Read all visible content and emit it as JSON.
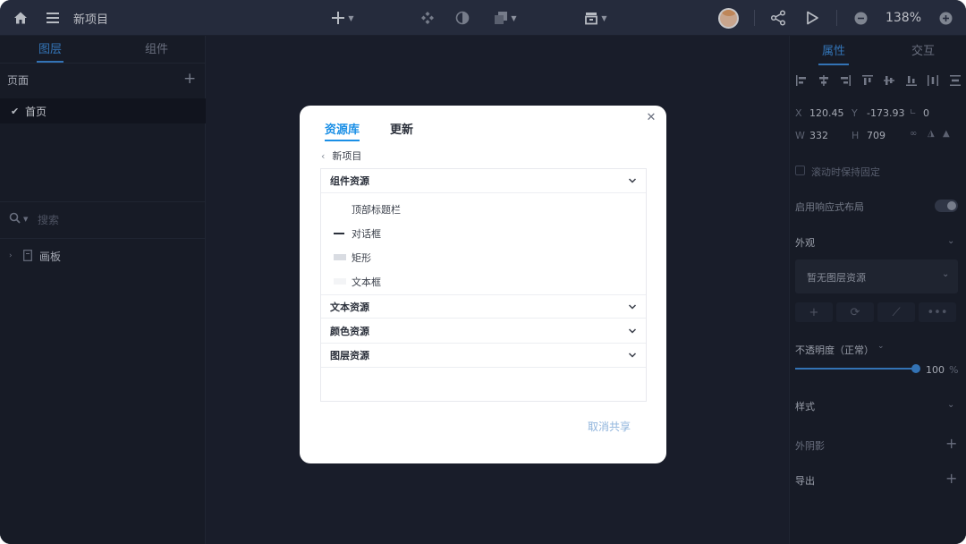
{
  "toolbar": {
    "title": "新项目",
    "zoom": "138%"
  },
  "left_panel": {
    "tabs": [
      "图层",
      "组件"
    ],
    "pages_label": "页面",
    "page_item": "首页",
    "search_placeholder": "搜索",
    "layer_item": "画板"
  },
  "right_panel": {
    "tabs": [
      "属性",
      "交互"
    ],
    "x_label": "X",
    "x_value": "120.45",
    "y_label": "Y",
    "y_value": "-173.93",
    "r_value": "0",
    "w_label": "W",
    "w_value": "332",
    "h_label": "H",
    "h_value": "709",
    "scroll_fixed": "滚动时保持固定",
    "responsive": "启用响应式布局",
    "appearance": "外观",
    "no_layer_resource": "暂无图层资源",
    "opacity_label": "不透明度（正常）",
    "opacity_value": "100",
    "opacity_unit": "%",
    "style": "样式",
    "outer_shadow": "外阴影",
    "export": "导出"
  },
  "modal": {
    "tabs": [
      "资源库",
      "更新"
    ],
    "back_label": "新项目",
    "groups": [
      {
        "label": "组件资源",
        "items": [
          "顶部标题栏",
          "对话框",
          "矩形",
          "文本框"
        ]
      },
      {
        "label": "文本资源"
      },
      {
        "label": "颜色资源"
      },
      {
        "label": "图层资源"
      }
    ],
    "footer_action": "取消共享"
  },
  "colors": {
    "accent": "#3d8bd9",
    "modal_accent": "#1a8fe6",
    "toolbar_bg": "#2d3446",
    "panel_bg": "#1b202b",
    "canvas_bg": "#1e2330"
  },
  "icons": [
    "home-icon",
    "menu-icon",
    "plus-icon",
    "component-icon",
    "mask-icon",
    "boolean-icon",
    "frame-tool-icon",
    "avatar",
    "share-icon",
    "play-icon",
    "zoom-out-icon",
    "zoom-in-icon",
    "check-icon",
    "search-icon",
    "page-icon",
    "close-icon",
    "chevron-down-icon"
  ]
}
